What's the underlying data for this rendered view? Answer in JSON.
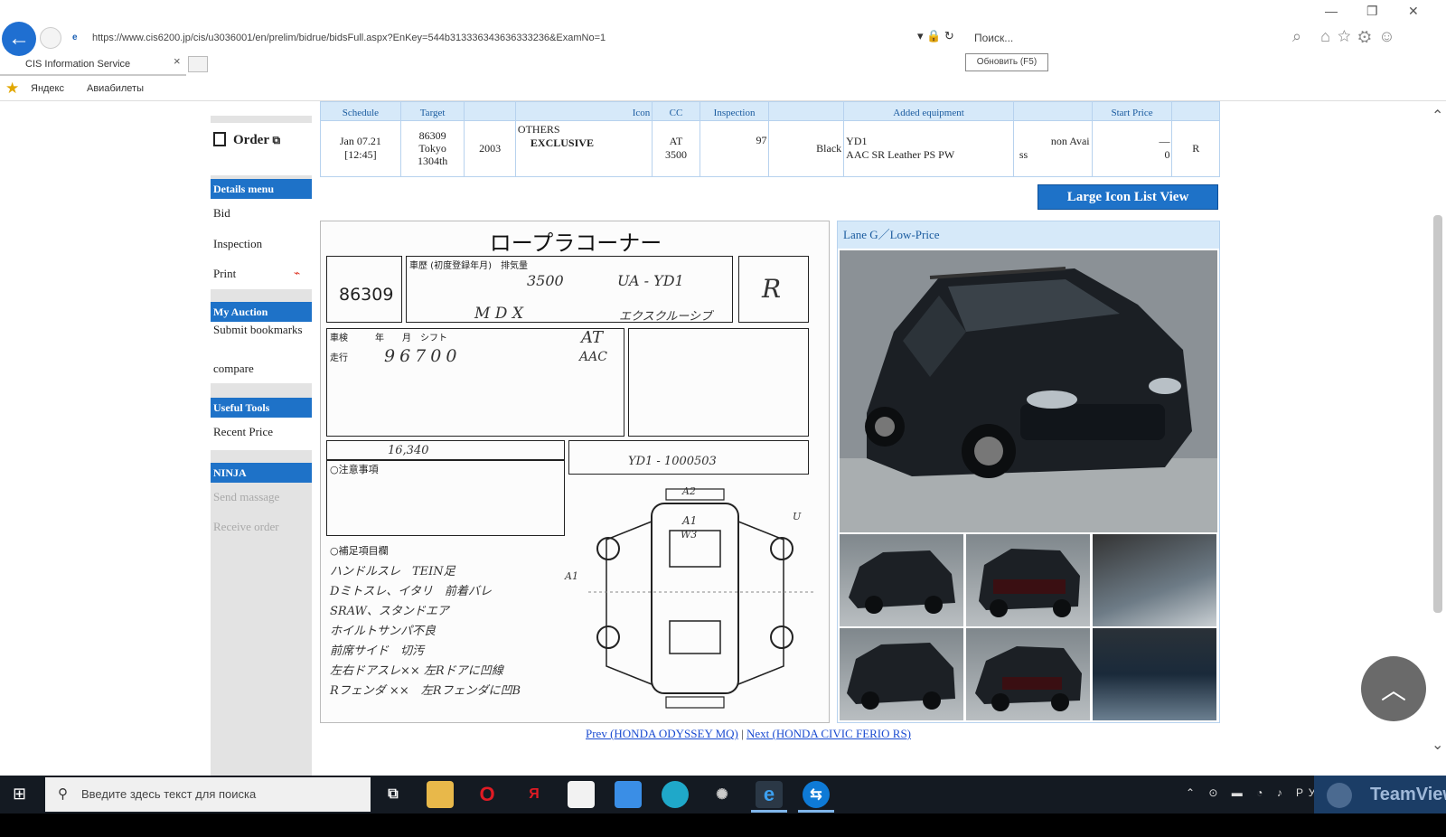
{
  "browser": {
    "url": "https://www.cis6200.jp/cis/u3036001/en/prelim/bidrue/bidsFull.aspx?EnKey=544b313336343636333236&ExamNo=1",
    "search_placeholder": "Поиск...",
    "tooltip": "Обновить (F5)",
    "tab_title": "CIS Information Service",
    "tab_close": "×",
    "favorites": [
      "Яндекс",
      "Авиабилеты"
    ]
  },
  "sidebar": {
    "order_label": "Order",
    "details_header": "Details menu",
    "details_items": [
      "Bid",
      "Inspection",
      "Print"
    ],
    "my_auction_header": "My Auction",
    "my_auction_items": [
      "Submit bookmarks",
      "compare"
    ],
    "useful_tools_header": "Useful Tools",
    "useful_tools_items": [
      "Recent Price"
    ],
    "ninja_header": "NINJA",
    "ninja_items": [
      "Send massage",
      "Receive order"
    ]
  },
  "lot": {
    "headers": [
      "Schedule",
      "Target",
      "",
      "Icon",
      "CC",
      "Inspection",
      "",
      "Added equipment",
      "",
      "Start Price",
      ""
    ],
    "date": "Jan 07.21",
    "time": "[12:45]",
    "lot_no": "86309",
    "venue": "Tokyo",
    "venue_no": "1304th",
    "year": "2003",
    "maker": "OTHERS",
    "model": "EXCLUSIVE",
    "transmission": "AT",
    "cc": "3500",
    "mileage": "97",
    "color": "Black",
    "chassis": "YD1",
    "equipment": "AAC SR Leather PS PW",
    "equip2_line1": "non Avai",
    "equip2_line2": "ss",
    "start_price_dash": "—",
    "start_price_value": "0",
    "result": "R"
  },
  "large_view_button": "Large Icon List View",
  "sheet": {
    "title": "ロープラコーナー",
    "lot_number": "86309",
    "displacement": "3500",
    "model_code": "UA - YD1",
    "car_name": "M D X",
    "grade": "エクスクルーシブ",
    "score": "R",
    "shift": "AT",
    "mileage": "96700",
    "ac": "AAC",
    "chassis_no": "YD1 - 1000503",
    "recycle": "16,340",
    "notes_label": "○注意事項",
    "equipment_label": "○補足項目欄",
    "handwritten_notes": [
      "ハンドルスレ　TEIN足",
      "Dミトスレ、イタリ　前着バレ",
      "SRAW、スタンドエア",
      "ホイルトサンパ不良",
      "前席サイド　切汚",
      "左右ドアスレ×× 左Rドアに凹線",
      "Rフェンダ ××　左Rフェンダに凹B"
    ],
    "diagram_labels": [
      "A1",
      "W3",
      "A2",
      "U",
      "A1"
    ]
  },
  "photos": {
    "caption": "Lane G／Low-Price"
  },
  "pager": {
    "prev": "Prev (HONDA ODYSSEY MQ)",
    "separator": " | ",
    "next": "Next (HONDA CIVIC FERIO RS)"
  },
  "taskbar": {
    "search_placeholder": "Введите здесь текст для поиска",
    "teamviewer_label": "TeamViewer",
    "tray_lang": "РУС"
  }
}
